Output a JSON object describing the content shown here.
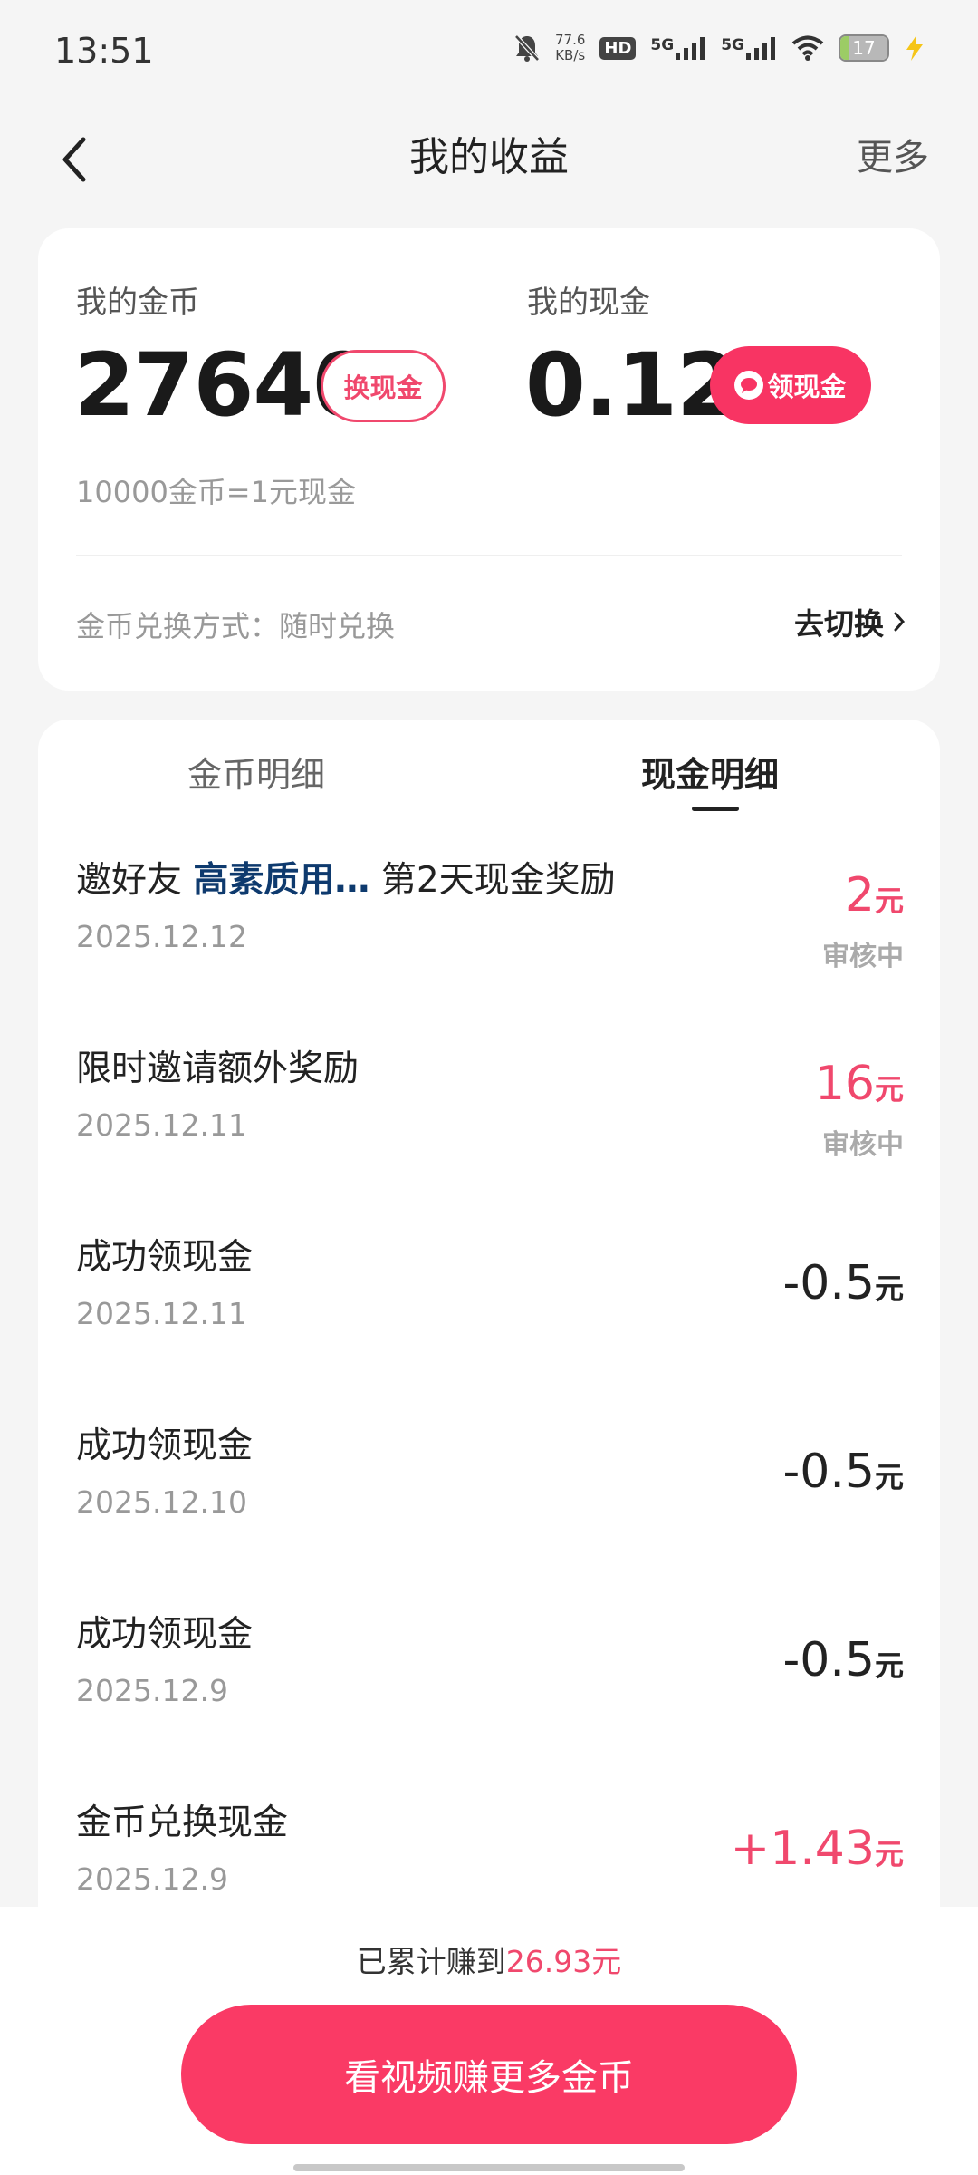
{
  "status_bar": {
    "time": "13:51",
    "net_speed_value": "77.6",
    "net_speed_unit": "KB/s",
    "hd_label": "HD",
    "signal_1_label": "5G",
    "signal_2_label": "5G",
    "battery_level": "17",
    "icons": [
      "bell-muted-icon",
      "hd-icon",
      "signal-icon",
      "wifi-icon",
      "battery-icon",
      "charging-icon"
    ]
  },
  "nav": {
    "title": "我的收益",
    "more_label": "更多",
    "back_icon": "chevron-left-icon"
  },
  "summary": {
    "coins_label": "我的金币",
    "coins_value": "27640",
    "exchange_button": "换现金",
    "cash_label": "我的现金",
    "cash_value": "0.12",
    "claim_button": "领现金",
    "rate_text": "10000金币=1元现金",
    "method_text": "金币兑换方式：随时兑换",
    "switch_label": "去切换"
  },
  "tabs": {
    "coin_detail": "金币明细",
    "cash_detail": "现金明细",
    "active": "cash_detail"
  },
  "rows": [
    {
      "title_prefix": "邀好友",
      "title_highlight": "高素质用…",
      "title_suffix": "第2天现金奖励",
      "date": "2025.12.12",
      "amount": "2",
      "unit": "元",
      "status": "审核中"
    },
    {
      "title": "限时邀请额外奖励",
      "date": "2025.12.11",
      "amount": "16",
      "unit": "元",
      "status": "审核中"
    },
    {
      "title": "成功领现金",
      "date": "2025.12.11",
      "amount": "-0.5",
      "unit": "元"
    },
    {
      "title": "成功领现金",
      "date": "2025.12.10",
      "amount": "-0.5",
      "unit": "元"
    },
    {
      "title": "成功领现金",
      "date": "2025.12.9",
      "amount": "-0.5",
      "unit": "元"
    },
    {
      "title": "金币兑换现金",
      "date": "2025.12.9",
      "amount": "+1.43",
      "unit": "元"
    }
  ],
  "bottom": {
    "total_prefix": "已累计赚到",
    "total_amount": "26.93元",
    "cta_label": "看视频赚更多金币"
  },
  "colors": {
    "accent": "#f83463",
    "accent_text": "#f0486d",
    "highlight_name": "#0e3a6e",
    "background": "#f5f5f5"
  }
}
